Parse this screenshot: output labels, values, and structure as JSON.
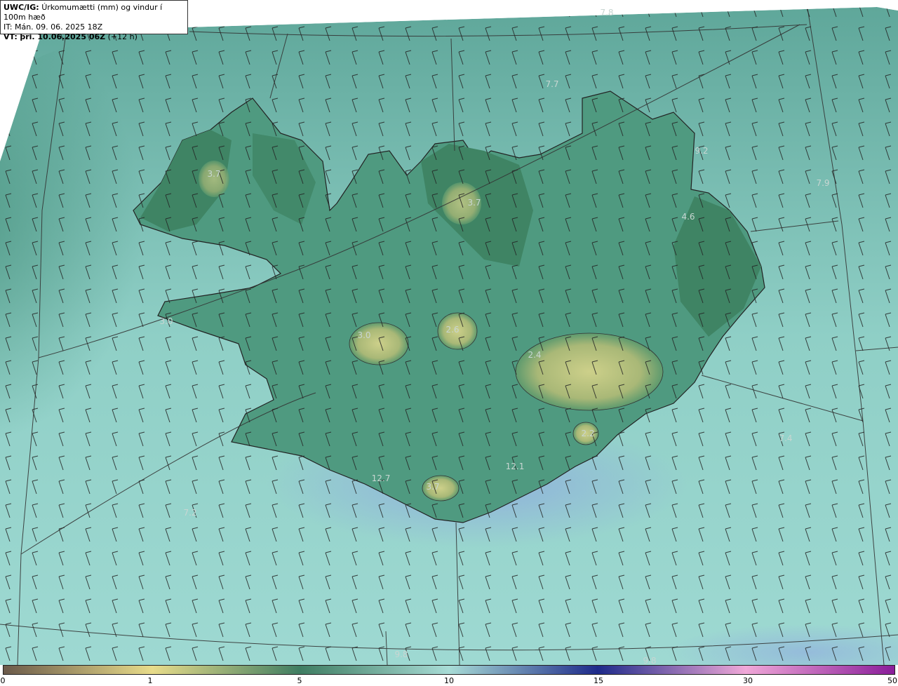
{
  "header": {
    "product": "UWC/IG:",
    "description": "Úrkomumætti (mm) og vindur í 100m hæð",
    "issue_time": "IT: Mán. 09. 06. 2025 18Z",
    "valid_label": "VT:",
    "valid_time": "þri. 10.06.2025 06Z",
    "lead_time": "(+12 h)"
  },
  "map_labels": [
    {
      "id": "lbl-1",
      "text": "7.8"
    },
    {
      "id": "lbl-2",
      "text": "7.7"
    },
    {
      "id": "lbl-3",
      "text": "3.7"
    },
    {
      "id": "lbl-4",
      "text": "3.7"
    },
    {
      "id": "lbl-5",
      "text": "9.2"
    },
    {
      "id": "lbl-6",
      "text": "7.9"
    },
    {
      "id": "lbl-7",
      "text": "4.6"
    },
    {
      "id": "lbl-8",
      "text": "3.0"
    },
    {
      "id": "lbl-9",
      "text": "3.0"
    },
    {
      "id": "lbl-10",
      "text": "2.6"
    },
    {
      "id": "lbl-11",
      "text": "2.4"
    },
    {
      "id": "lbl-12",
      "text": "2.2"
    },
    {
      "id": "lbl-13",
      "text": "7.4"
    },
    {
      "id": "lbl-14",
      "text": "12.1"
    },
    {
      "id": "lbl-15",
      "text": "3.7"
    },
    {
      "id": "lbl-16",
      "text": "12.7"
    },
    {
      "id": "lbl-17",
      "text": "7.2"
    },
    {
      "id": "lbl-18",
      "text": "9.8"
    },
    {
      "id": "lbl-19",
      "text": "9.8"
    }
  ],
  "legend": {
    "ticks": [
      "0",
      "1",
      "5",
      "10",
      "15",
      "30",
      "50"
    ],
    "colors": [
      "#6b5a4a",
      "#e8dc8a",
      "#3f7d62",
      "#a8dcd6",
      "#1e2a8a",
      "#f0a8d8",
      "#8a1e9a"
    ]
  }
}
